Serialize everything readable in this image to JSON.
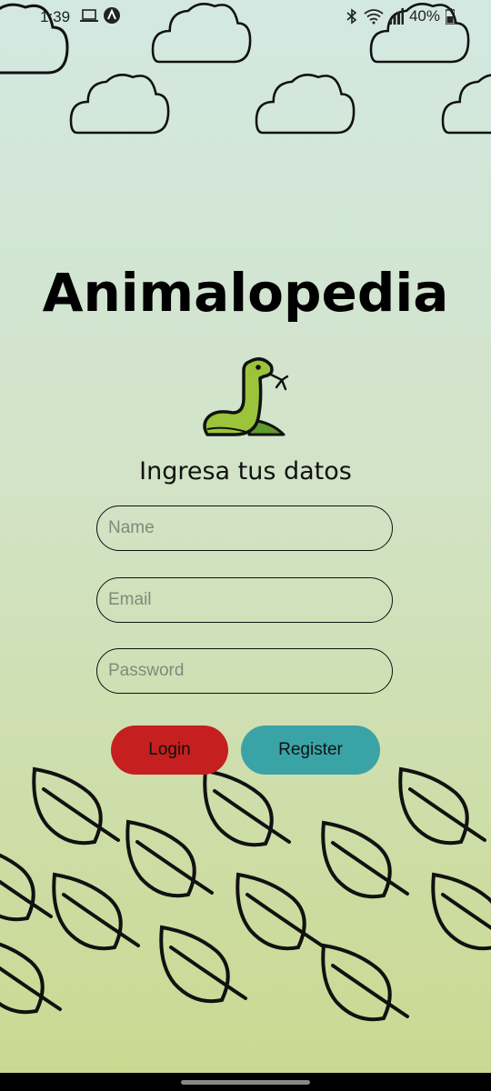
{
  "status_bar": {
    "time": "1:39",
    "battery_text": "40%",
    "icons": [
      "laptop-icon",
      "app-notification-icon",
      "bluetooth-icon",
      "wifi-icon",
      "signal-icon",
      "battery-icon"
    ]
  },
  "app": {
    "title": "Animalopedia",
    "logo_icon": "snake-icon",
    "subtitle": "Ingresa tus datos"
  },
  "form": {
    "name_placeholder": "Name",
    "email_placeholder": "Email",
    "password_placeholder": "Password",
    "name_value": "",
    "email_value": "",
    "password_value": ""
  },
  "buttons": {
    "login_label": "Login",
    "register_label": "Register"
  },
  "colors": {
    "login": "#c51f1f",
    "register": "#3aa3a6",
    "snake": "#9bc43a"
  }
}
